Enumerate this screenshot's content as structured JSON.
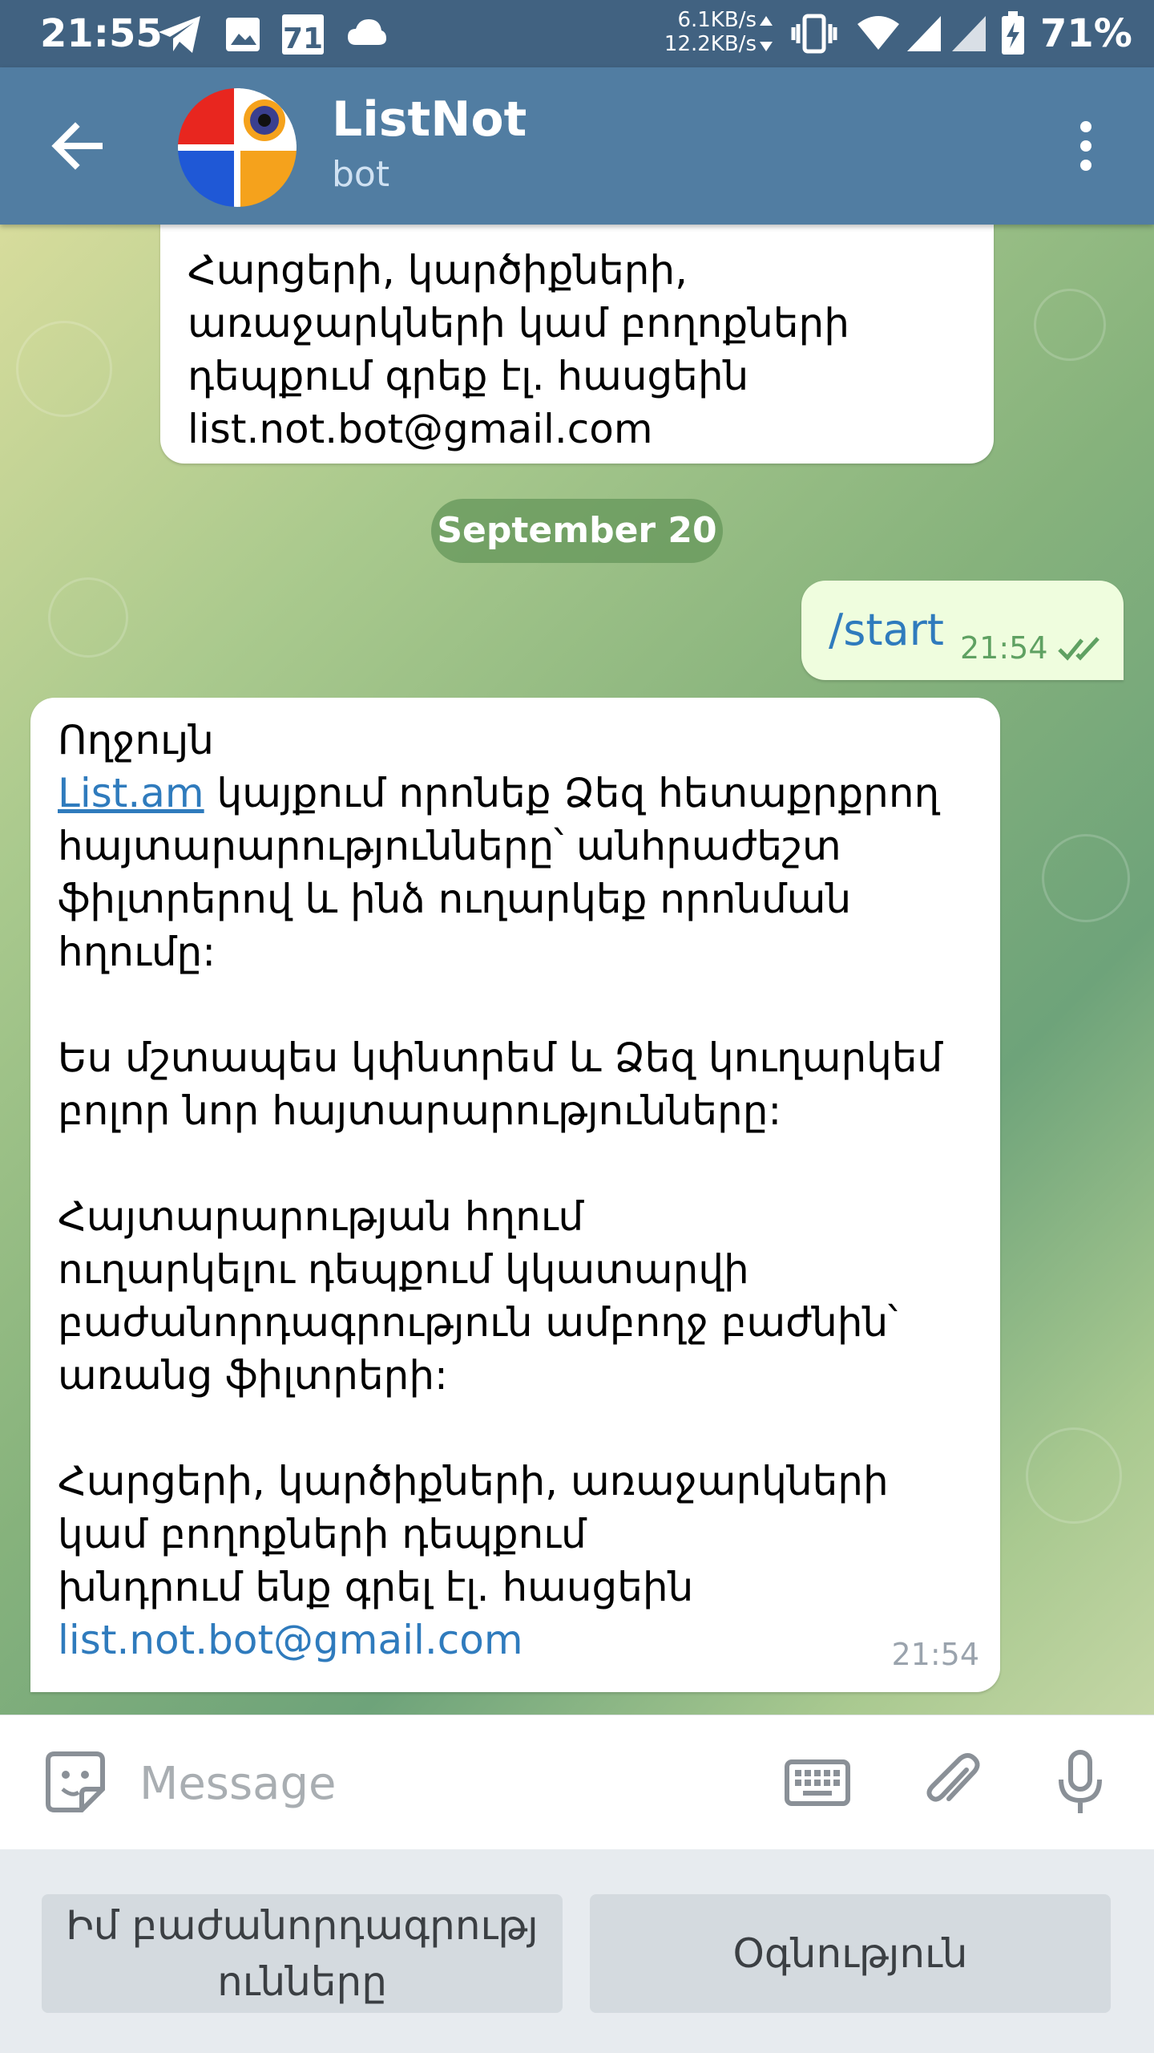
{
  "status_bar": {
    "time": "21:55",
    "icons": [
      "telegram-icon",
      "image-icon",
      "calendar-icon",
      "cloud-icon"
    ],
    "calendar_day": "71",
    "net_up": "6.1KB/s",
    "net_down": "12.2KB/s",
    "right_icons": [
      "vibrate-icon",
      "wifi-icon",
      "signal-icon",
      "signal-icon",
      "battery-charging-icon"
    ],
    "battery": "71%"
  },
  "header": {
    "name": "ListNot",
    "subtitle": "bot",
    "colors": {
      "bar": "#517da2",
      "status": "#416281"
    }
  },
  "chat": {
    "prev_message": {
      "lines": [
        "Հարցերի, կարծիքների,",
        "առաջարկների կամ բողոքների",
        "դեպքում գրեք էլ. հասցեին",
        "list.not.bot@gmail.com"
      ]
    },
    "date_separator": "September 20",
    "outgoing": {
      "text": "/start",
      "time": "21:54"
    },
    "incoming": {
      "p1_line1": "Ողջույն",
      "p1_link": "List.am",
      "p1_line2_rest": " կայքում որոնեք Ձեզ հետաքրքրող",
      "p1_line3": "հայտարարությունները՝ անհրաժեշտ",
      "p1_line4": "ֆիլտրերով և ինձ ուղարկեք որոնման",
      "p1_line5": "հղումը:",
      "p2_line1": "Ես մշտապես կփնտրեմ և Ձեզ կուղարկեմ",
      "p2_line2": "բոլոր նոր հայտարարությունները:",
      "p3_line1": "Հայտարարության հղում",
      "p3_line2": "ուղարկելու դեպքում կկատարվի",
      "p3_line3": "բաժանորդագրություն ամբողջ բաժնին՝",
      "p3_line4": "առանց ֆիլտրերի:",
      "p4_line1": "Հարցերի, կարծիքների, առաջարկների",
      "p4_line2": "կամ բողոքների դեպքում",
      "p4_line3": "խնդրում ենք գրել էլ. հասցեին",
      "p4_email": "list.not.bot@gmail.com",
      "time": "21:54"
    }
  },
  "input_bar": {
    "placeholder": "Message",
    "icons": [
      "sticker-icon",
      "keyboard-icon",
      "attach-icon",
      "microphone-icon"
    ]
  },
  "bot_keyboard": {
    "buttons": [
      "Իմ բաժանորդագրությ ունները",
      "Օգնություն"
    ]
  }
}
